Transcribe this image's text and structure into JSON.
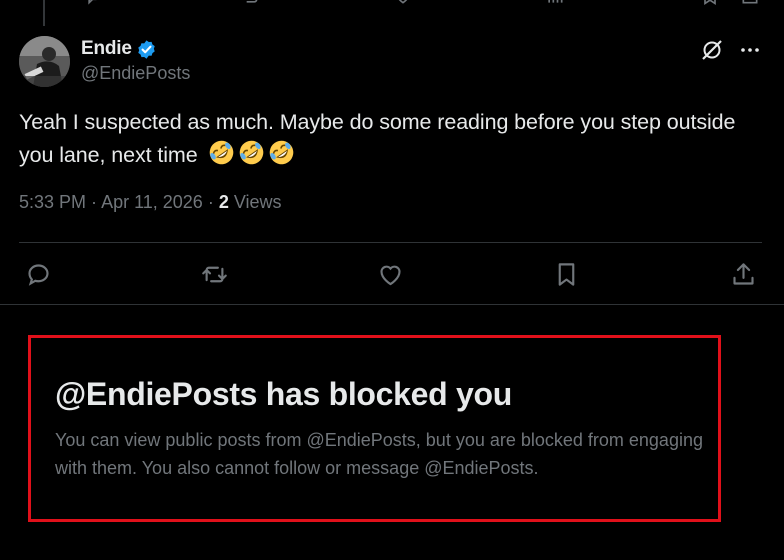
{
  "author": {
    "name": "Endie",
    "handle": "@EndiePosts",
    "verified": true,
    "verified_color": "#1d9bf0"
  },
  "post": {
    "text": "Yeah I suspected as much. Maybe do some reading before you step outside you lane, next time",
    "emojis": [
      "rolling-on-floor-laughing",
      "rolling-on-floor-laughing",
      "rolling-on-floor-laughing"
    ],
    "time": "5:33 PM",
    "separator": " · ",
    "date": "Apr 11, 2026",
    "views_count": "2",
    "views_label": "Views"
  },
  "header_icons": [
    "grok-icon",
    "more-icon"
  ],
  "actions": [
    "reply-icon",
    "repost-icon",
    "like-icon",
    "bookmark-icon",
    "share-icon"
  ],
  "blocked_notice": {
    "title": "@EndiePosts has blocked you",
    "body": "You can view public posts from @EndiePosts, but you are blocked from engaging with them. You also cannot follow or message @EndiePosts.",
    "highlight_color": "#e0101a"
  },
  "colors": {
    "background": "#000000",
    "text_primary": "#e7e9ea",
    "text_secondary": "#71767b",
    "divider": "#2f3336"
  }
}
